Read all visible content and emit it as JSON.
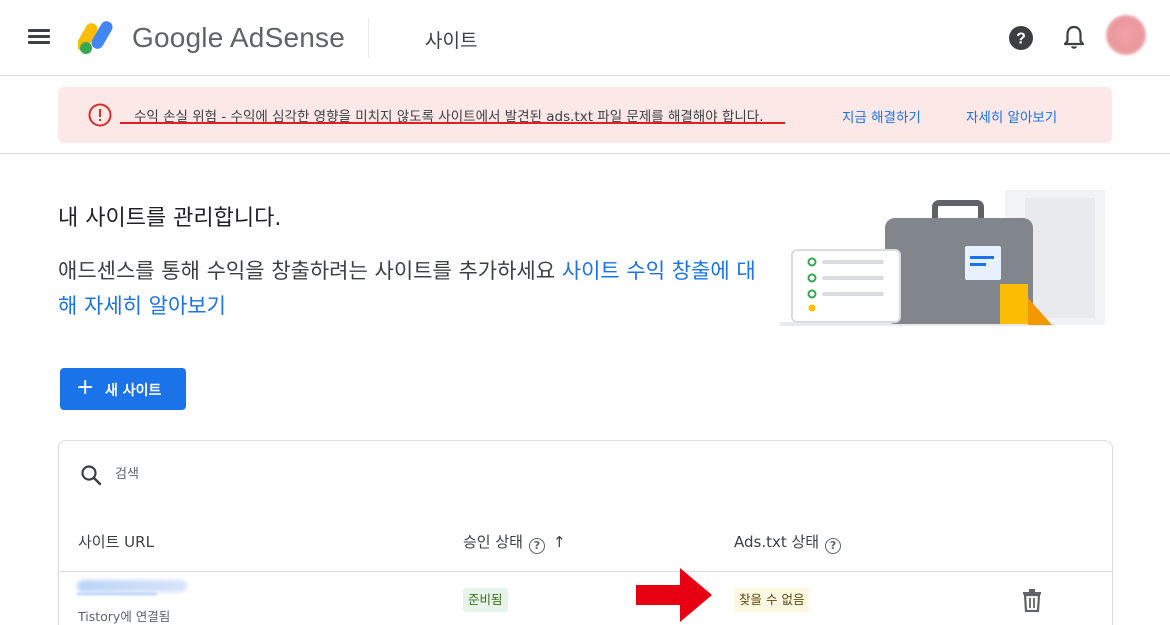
{
  "header": {
    "app_name": "Google AdSense",
    "page_title": "사이트",
    "icons": [
      "menu-icon",
      "adsense-logo",
      "help-icon",
      "notification-bell-icon",
      "account-avatar"
    ]
  },
  "alert": {
    "message": "수익 손실 위험 - 수익에 심각한 영향을 미치지 않도록 사이트에서 발견된 ads.txt 파일 문제를 해결해야 합니다.",
    "fix_now": "지금 해결하기",
    "learn_more": "자세히 알아보기",
    "icon": "error-icon"
  },
  "hero": {
    "title": "내 사이트를 관리합니다.",
    "description": "애드센스를 통해 수익을 창출하려는 사이트를 추가하세요",
    "link": "사이트 수익 창출에 대해 자세히 알아보기"
  },
  "actions": {
    "new_site": "새 사이트"
  },
  "table": {
    "search_placeholder": "검색",
    "columns": {
      "url": "사이트 URL",
      "approval": "승인 상태",
      "adstxt": "Ads.txt 상태"
    },
    "rows": [
      {
        "connected": "Tistory에 연결됨",
        "approval_status": "준비됨",
        "adstxt_status": "찾을 수 없음"
      }
    ]
  },
  "colors": {
    "primary": "#1a73e8",
    "alert_bg": "#fce8e6",
    "alert_icon": "#d93025",
    "ready_chip_bg": "#e6f4ea",
    "notfound_chip_bg": "#fdf6e0",
    "annotation_red": "#e60012"
  }
}
